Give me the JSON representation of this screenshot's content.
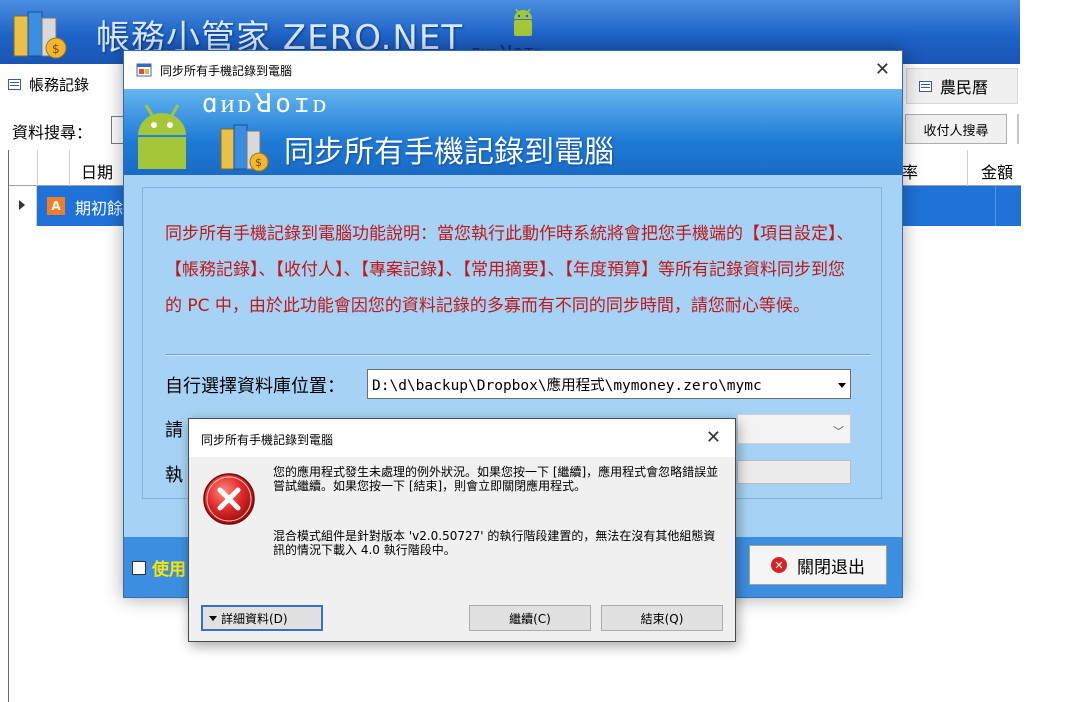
{
  "app": {
    "banner_title": "帳務小管家 ZERO.NET",
    "banner_android_word": "ɑᴎᴅꓤoɪᴅ",
    "tab_left_label": "帳務記錄",
    "tab_right_label": "農民曆",
    "search_label": "資料搜尋：",
    "payee_search_label": "收付人搜尋",
    "grid": {
      "headers": [
        "日期",
        "率",
        "金額"
      ],
      "row": {
        "badge": "A",
        "text": "期初餘"
      }
    }
  },
  "sync_dialog": {
    "title": "同步所有手機記錄到電腦",
    "header_android_word": "ɑᴎᴅꓤoɪᴅ",
    "header_title": "同步所有手機記錄到電腦",
    "description": "同步所有手機記錄到電腦功能說明：當您執行此動作時系統將會把您手機端的【項目設定】、【帳務記錄】、【收付人】、【專案記錄】、【常用摘要】、【年度預算】等所有記錄資料同步到您的 PC 中，由於此功能會因您的資料記錄的多寡而有不同的同步時間，請您耐心等候。",
    "db_location_label": "自行選擇資料庫位置：",
    "db_path": "D:\\d\\backup\\Dropbox\\應用程式\\mymoney.zero\\mymc",
    "request_label": "請",
    "exec_label": "執",
    "use_label": "使用",
    "close_button": "關閉退出"
  },
  "error_dialog": {
    "title": "同步所有手機記錄到電腦",
    "message1": "您的應用程式發生未處理的例外狀況。如果您按一下 [繼續]，應用程式會忽略錯誤並嘗試繼續。如果您按一下 [結束]，則會立即關閉應用程式。",
    "message2": "混合模式組件是針對版本 'v2.0.50727' 的執行階段建置的，無法在沒有其他組態資訊的情況下載入 4.0 執行階段中。",
    "details_button": "詳細資料(D)",
    "continue_button": "繼續(C)",
    "quit_button": "結束(Q)"
  },
  "icons": {
    "error_icon_color": "#d7222a",
    "banner_color": "#1e63c8",
    "selected_row_color": "#1f72d8"
  }
}
